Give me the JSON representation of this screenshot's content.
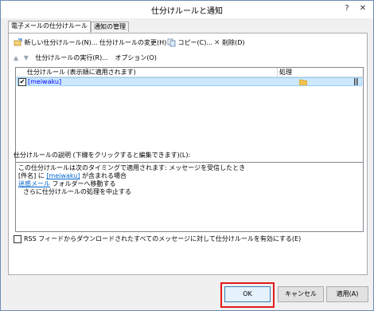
{
  "window": {
    "title": "仕分けルールと通知"
  },
  "tabs": [
    {
      "label": "電子メールの仕分けルール"
    },
    {
      "label": "通知の管理"
    }
  ],
  "toolbar": {
    "new_rule": "新しい仕分けルール(N)...",
    "change_rule": "仕分けルールの変更(H)",
    "copy": "コピー(C)...",
    "delete": "削除(D)"
  },
  "order_row": {
    "run_rules": "仕分けルールの実行(R)...",
    "options": "オプション(O)"
  },
  "rules_list": {
    "columns": [
      "仕分けルール (表示順に適用されます)",
      "処理"
    ],
    "rows": [
      {
        "name": "[meiwaku]",
        "checked": true
      }
    ]
  },
  "description": {
    "label": "仕分けルールの説明 (下線をクリックすると編集できます)(L):",
    "line1": "この仕分けルールは次のタイミングで適用されます: メッセージを受信したとき",
    "line2_a": "[件名] に",
    "line2_link": "[meiwaku]",
    "line2_b": "が含まれる場合",
    "line3_link": "迷惑メール",
    "line3_b": "フォルダーへ移動する",
    "line4": "さらに仕分けルールの処理を中止する"
  },
  "rss_option": {
    "label": "RSS フィードからダウンロードされたすべてのメッセージに対して仕分けルールを有効にする(E)",
    "checked": false
  },
  "buttons": {
    "ok": "OK",
    "cancel": "キャンセル",
    "apply": "適用(A)"
  },
  "colors": {
    "selection": "#cce8ff",
    "link": "#0066cc",
    "highlight": "#e21b1b"
  }
}
